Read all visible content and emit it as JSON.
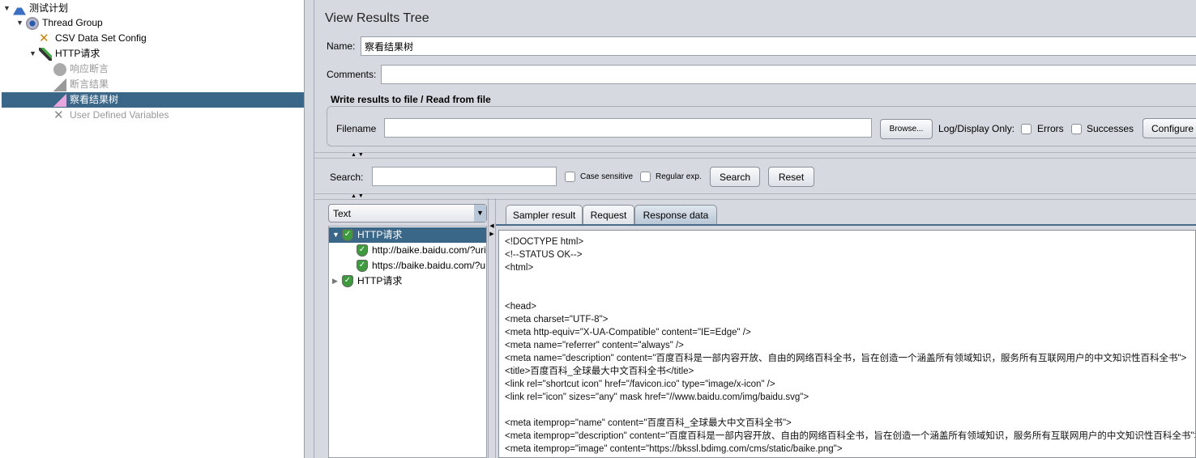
{
  "tree": {
    "items": [
      {
        "label": "测试计划",
        "icon": "flask-icon"
      },
      {
        "label": "Thread Group",
        "icon": "gear-icon"
      },
      {
        "label": "CSV Data Set Config",
        "icon": "wrench-icon"
      },
      {
        "label": "HTTP请求",
        "icon": "pipette-icon"
      },
      {
        "label": "响应断言",
        "icon": "magnifier-icon"
      },
      {
        "label": "断言结果",
        "icon": "chart-icon"
      },
      {
        "label": "察看结果树",
        "icon": "graph-icon"
      },
      {
        "label": "User Defined Variables",
        "icon": "wrench-icon"
      }
    ]
  },
  "panel": {
    "title": "View Results Tree",
    "name_label": "Name:",
    "name_value": "察看结果树",
    "comments_label": "Comments:",
    "comments_value": "",
    "file_section_title": "Write results to file / Read from file",
    "filename_label": "Filename",
    "filename_value": "",
    "browse_label": "Browse...",
    "log_display_label": "Log/Display Only:",
    "errors_label": "Errors",
    "successes_label": "Successes",
    "configure_label": "Configure",
    "search_label": "Search:",
    "search_value": "",
    "case_sensitive_label": "Case sensitive",
    "regex_label": "Regular exp.",
    "search_button": "Search",
    "reset_button": "Reset",
    "renderer_selected": "Text"
  },
  "results": [
    {
      "label": "HTTP请求"
    },
    {
      "label": "http://baike.baidu.com/?uri=/ajax"
    },
    {
      "label": "https://baike.baidu.com/?uri=/ajax"
    },
    {
      "label": "HTTP请求"
    }
  ],
  "tabs": [
    "Sampler result",
    "Request",
    "Response data"
  ],
  "response_lines": [
    "<!DOCTYPE html>",
    "<!--STATUS OK-->",
    "<html>",
    "",
    "",
    "<head>",
    "<meta charset=\"UTF-8\">",
    "<meta http-equiv=\"X-UA-Compatible\" content=\"IE=Edge\" />",
    "<meta name=\"referrer\" content=\"always\" />",
    "<meta name=\"description\" content=\"百度百科是一部内容开放、自由的网络百科全书，旨在创造一个涵盖所有领域知识，服务所有互联网用户的中文知识性百科全书\">",
    "<title>百度百科_全球最大中文百科全书</title>",
    "<link rel=\"shortcut icon\" href=\"/favicon.ico\" type=\"image/x-icon\" />",
    "<link rel=\"icon\" sizes=\"any\" mask href=\"//www.baidu.com/img/baidu.svg\">",
    "",
    "<meta itemprop=\"name\" content=\"百度百科_全球最大中文百科全书\">",
    "<meta itemprop=\"description\" content=\"百度百科是一部内容开放、自由的网络百科全书，旨在创造一个涵盖所有领域知识，服务所有互联网用户的中文知识性百科全书\">",
    "<meta itemprop=\"image\" content=\"https://bkssl.bdimg.com/cms/static/baike.png\">"
  ]
}
